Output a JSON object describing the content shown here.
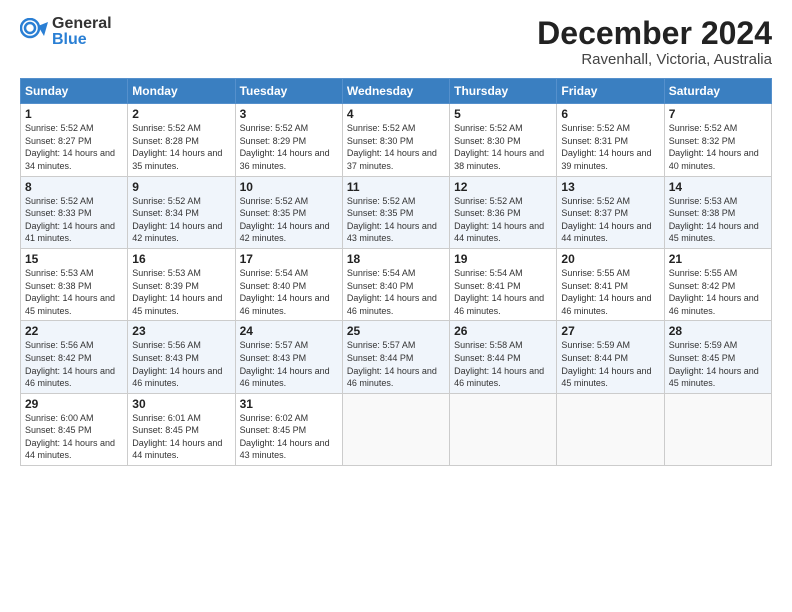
{
  "logo": {
    "general": "General",
    "blue": "Blue"
  },
  "header": {
    "month": "December 2024",
    "location": "Ravenhall, Victoria, Australia"
  },
  "days_of_week": [
    "Sunday",
    "Monday",
    "Tuesday",
    "Wednesday",
    "Thursday",
    "Friday",
    "Saturday"
  ],
  "weeks": [
    [
      {
        "day": "1",
        "sunrise": "5:52 AM",
        "sunset": "8:27 PM",
        "daylight": "14 hours and 34 minutes."
      },
      {
        "day": "2",
        "sunrise": "5:52 AM",
        "sunset": "8:28 PM",
        "daylight": "14 hours and 35 minutes."
      },
      {
        "day": "3",
        "sunrise": "5:52 AM",
        "sunset": "8:29 PM",
        "daylight": "14 hours and 36 minutes."
      },
      {
        "day": "4",
        "sunrise": "5:52 AM",
        "sunset": "8:30 PM",
        "daylight": "14 hours and 37 minutes."
      },
      {
        "day": "5",
        "sunrise": "5:52 AM",
        "sunset": "8:30 PM",
        "daylight": "14 hours and 38 minutes."
      },
      {
        "day": "6",
        "sunrise": "5:52 AM",
        "sunset": "8:31 PM",
        "daylight": "14 hours and 39 minutes."
      },
      {
        "day": "7",
        "sunrise": "5:52 AM",
        "sunset": "8:32 PM",
        "daylight": "14 hours and 40 minutes."
      }
    ],
    [
      {
        "day": "8",
        "sunrise": "5:52 AM",
        "sunset": "8:33 PM",
        "daylight": "14 hours and 41 minutes."
      },
      {
        "day": "9",
        "sunrise": "5:52 AM",
        "sunset": "8:34 PM",
        "daylight": "14 hours and 42 minutes."
      },
      {
        "day": "10",
        "sunrise": "5:52 AM",
        "sunset": "8:35 PM",
        "daylight": "14 hours and 42 minutes."
      },
      {
        "day": "11",
        "sunrise": "5:52 AM",
        "sunset": "8:35 PM",
        "daylight": "14 hours and 43 minutes."
      },
      {
        "day": "12",
        "sunrise": "5:52 AM",
        "sunset": "8:36 PM",
        "daylight": "14 hours and 44 minutes."
      },
      {
        "day": "13",
        "sunrise": "5:52 AM",
        "sunset": "8:37 PM",
        "daylight": "14 hours and 44 minutes."
      },
      {
        "day": "14",
        "sunrise": "5:53 AM",
        "sunset": "8:38 PM",
        "daylight": "14 hours and 45 minutes."
      }
    ],
    [
      {
        "day": "15",
        "sunrise": "5:53 AM",
        "sunset": "8:38 PM",
        "daylight": "14 hours and 45 minutes."
      },
      {
        "day": "16",
        "sunrise": "5:53 AM",
        "sunset": "8:39 PM",
        "daylight": "14 hours and 45 minutes."
      },
      {
        "day": "17",
        "sunrise": "5:54 AM",
        "sunset": "8:40 PM",
        "daylight": "14 hours and 46 minutes."
      },
      {
        "day": "18",
        "sunrise": "5:54 AM",
        "sunset": "8:40 PM",
        "daylight": "14 hours and 46 minutes."
      },
      {
        "day": "19",
        "sunrise": "5:54 AM",
        "sunset": "8:41 PM",
        "daylight": "14 hours and 46 minutes."
      },
      {
        "day": "20",
        "sunrise": "5:55 AM",
        "sunset": "8:41 PM",
        "daylight": "14 hours and 46 minutes."
      },
      {
        "day": "21",
        "sunrise": "5:55 AM",
        "sunset": "8:42 PM",
        "daylight": "14 hours and 46 minutes."
      }
    ],
    [
      {
        "day": "22",
        "sunrise": "5:56 AM",
        "sunset": "8:42 PM",
        "daylight": "14 hours and 46 minutes."
      },
      {
        "day": "23",
        "sunrise": "5:56 AM",
        "sunset": "8:43 PM",
        "daylight": "14 hours and 46 minutes."
      },
      {
        "day": "24",
        "sunrise": "5:57 AM",
        "sunset": "8:43 PM",
        "daylight": "14 hours and 46 minutes."
      },
      {
        "day": "25",
        "sunrise": "5:57 AM",
        "sunset": "8:44 PM",
        "daylight": "14 hours and 46 minutes."
      },
      {
        "day": "26",
        "sunrise": "5:58 AM",
        "sunset": "8:44 PM",
        "daylight": "14 hours and 46 minutes."
      },
      {
        "day": "27",
        "sunrise": "5:59 AM",
        "sunset": "8:44 PM",
        "daylight": "14 hours and 45 minutes."
      },
      {
        "day": "28",
        "sunrise": "5:59 AM",
        "sunset": "8:45 PM",
        "daylight": "14 hours and 45 minutes."
      }
    ],
    [
      {
        "day": "29",
        "sunrise": "6:00 AM",
        "sunset": "8:45 PM",
        "daylight": "14 hours and 44 minutes."
      },
      {
        "day": "30",
        "sunrise": "6:01 AM",
        "sunset": "8:45 PM",
        "daylight": "14 hours and 44 minutes."
      },
      {
        "day": "31",
        "sunrise": "6:02 AM",
        "sunset": "8:45 PM",
        "daylight": "14 hours and 43 minutes."
      },
      null,
      null,
      null,
      null
    ]
  ]
}
